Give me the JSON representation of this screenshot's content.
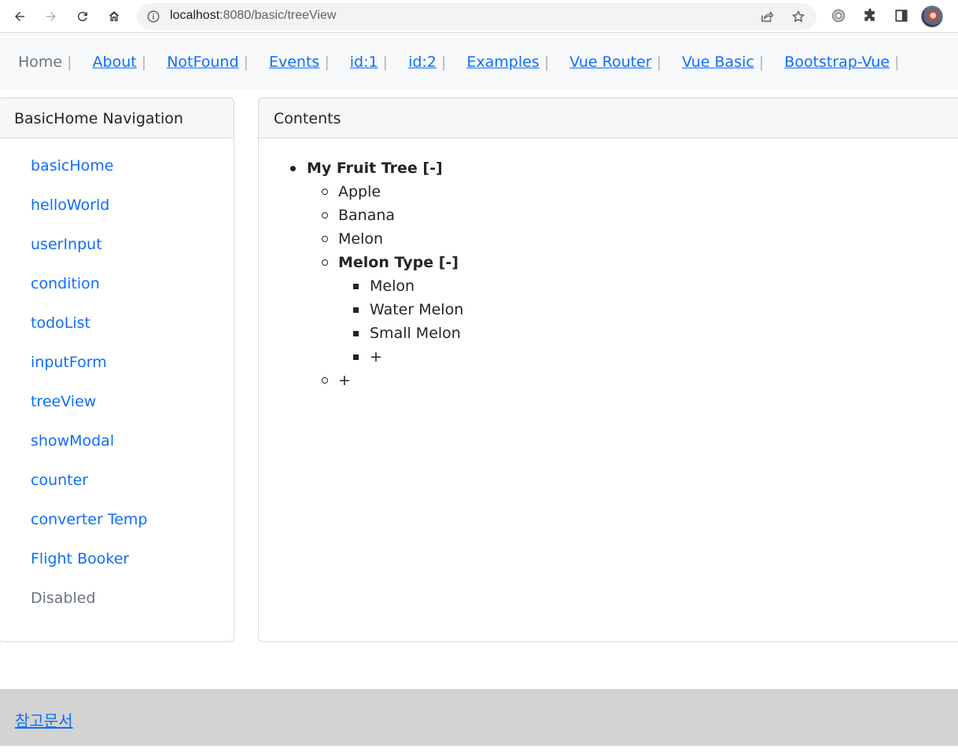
{
  "browser": {
    "url_host": "localhost",
    "url_path": ":8080/basic/treeView"
  },
  "topnav": {
    "home": "Home",
    "links": [
      "About",
      "NotFound",
      "Events",
      "id:1",
      "id:2",
      "Examples",
      "Vue Router",
      "Vue Basic",
      "Bootstrap-Vue"
    ],
    "separator": "|"
  },
  "sidebar": {
    "title": "BasicHome Navigation",
    "items": [
      "basicHome",
      "helloWorld",
      "userInput",
      "condition",
      "todoList",
      "inputForm",
      "treeView",
      "showModal",
      "counter",
      "converter Temp",
      "Flight Booker"
    ],
    "disabled_item": "Disabled"
  },
  "content": {
    "title": "Contents",
    "tree": {
      "root": "My Fruit Tree",
      "toggle": "[-]",
      "children": [
        "Apple",
        "Banana",
        "Melon"
      ],
      "subfolder": {
        "name": "Melon Type",
        "toggle": "[-]",
        "children": [
          "Melon",
          "Water Melon",
          "Small Melon"
        ],
        "add": "+"
      },
      "add": "+"
    }
  },
  "footer": {
    "link": "참고문서"
  }
}
